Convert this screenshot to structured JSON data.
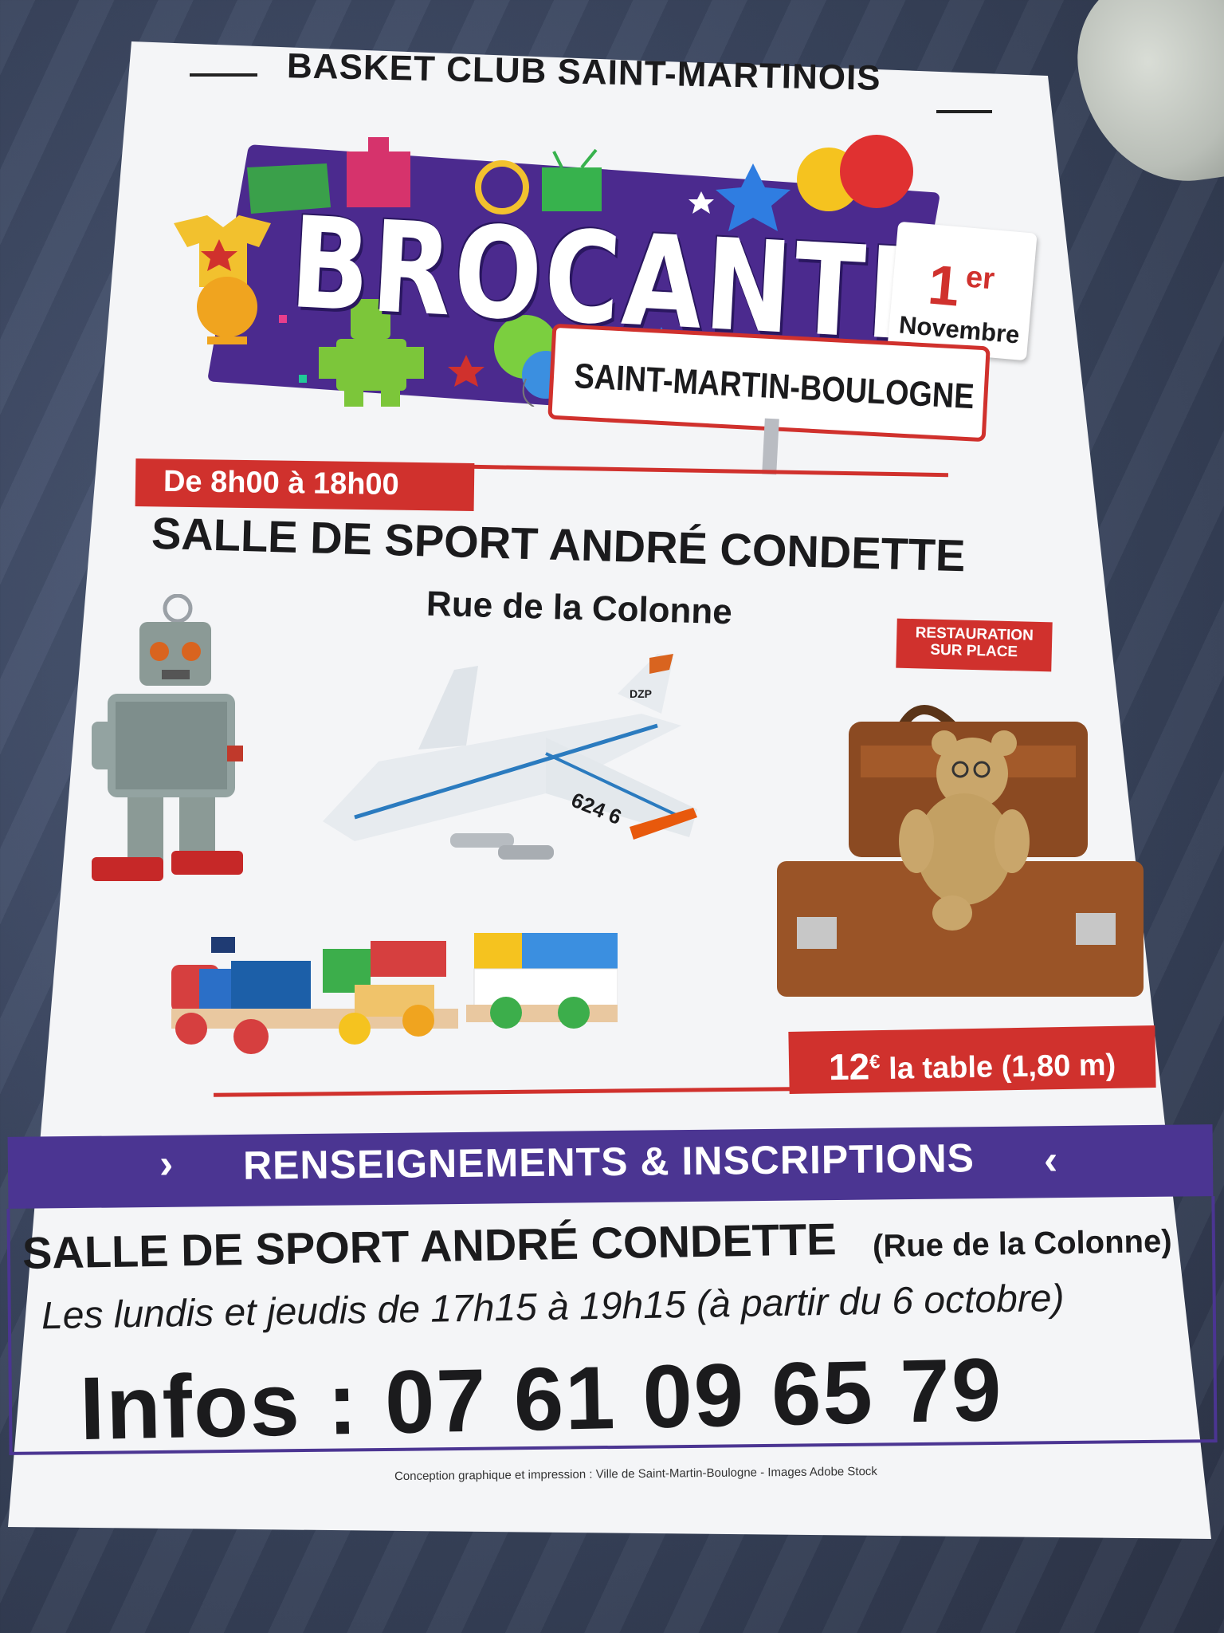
{
  "poster": {
    "club": "BASKET CLUB SAINT-MARTINOIS",
    "title": "BROCANTE",
    "date_day": "1",
    "date_suffix": "er",
    "date_month": "Novembre",
    "town": "SAINT-MARTIN-BOULOGNE",
    "hours": "De 8h00 à 18h00",
    "venue": "SALLE DE SPORT ANDRÉ CONDETTE",
    "street": "Rue de la Colonne",
    "restaurant_line1": "RESTAURATION",
    "restaurant_line2": "SUR PLACE",
    "price_amount": "12",
    "price_currency": "€",
    "price_detail": "la table (1,80 m)",
    "info_band": "RENSEIGNEMENTS & INSCRIPTIONS",
    "info_venue": "SALLE DE SPORT ANDRÉ CONDETTE",
    "info_street": "(Rue de la Colonne)",
    "info_days": "Les lundis et jeudis de 17h15 à 19h15 (à partir du 6 octobre)",
    "phone_label": "Infos : 07 61 09 65 79",
    "credit": "Conception graphique et impression : Ville de Saint-Martin-Boulogne - Images Adobe Stock",
    "plane_code": "624 6",
    "plane_tail": "DZP"
  },
  "colors": {
    "red": "#d0312d",
    "purple": "#4b3592",
    "background_fabric": "#3a455e"
  },
  "icons": [
    "robot-icon",
    "airplane-icon",
    "train-icon",
    "suitcase-icon",
    "teddy-bear-icon",
    "balloon-icon",
    "star-icon"
  ]
}
